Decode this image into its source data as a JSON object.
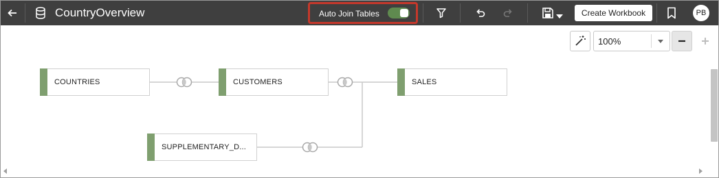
{
  "header": {
    "title": "CountryOverview",
    "auto_join_label": "Auto Join Tables",
    "auto_join_enabled": true,
    "create_workbook_label": "Create Workbook",
    "avatar_initials": "PB"
  },
  "canvas": {
    "zoom_value": "100%",
    "nodes": [
      {
        "label": "COUNTRIES"
      },
      {
        "label": "CUSTOMERS"
      },
      {
        "label": "SALES"
      },
      {
        "label": "SUPPLEMENTARY_D..."
      }
    ]
  },
  "colors": {
    "toolbar_bg": "#3f3f3f",
    "highlight_border": "#c6382b",
    "toggle_on": "#5f8a4f",
    "node_accent": "#7f9f6f"
  },
  "icons": [
    "back-arrow-icon",
    "database-icon",
    "filter-icon",
    "undo-icon",
    "redo-icon",
    "save-icon",
    "bookmark-icon",
    "magic-wand-icon",
    "join-icon"
  ]
}
